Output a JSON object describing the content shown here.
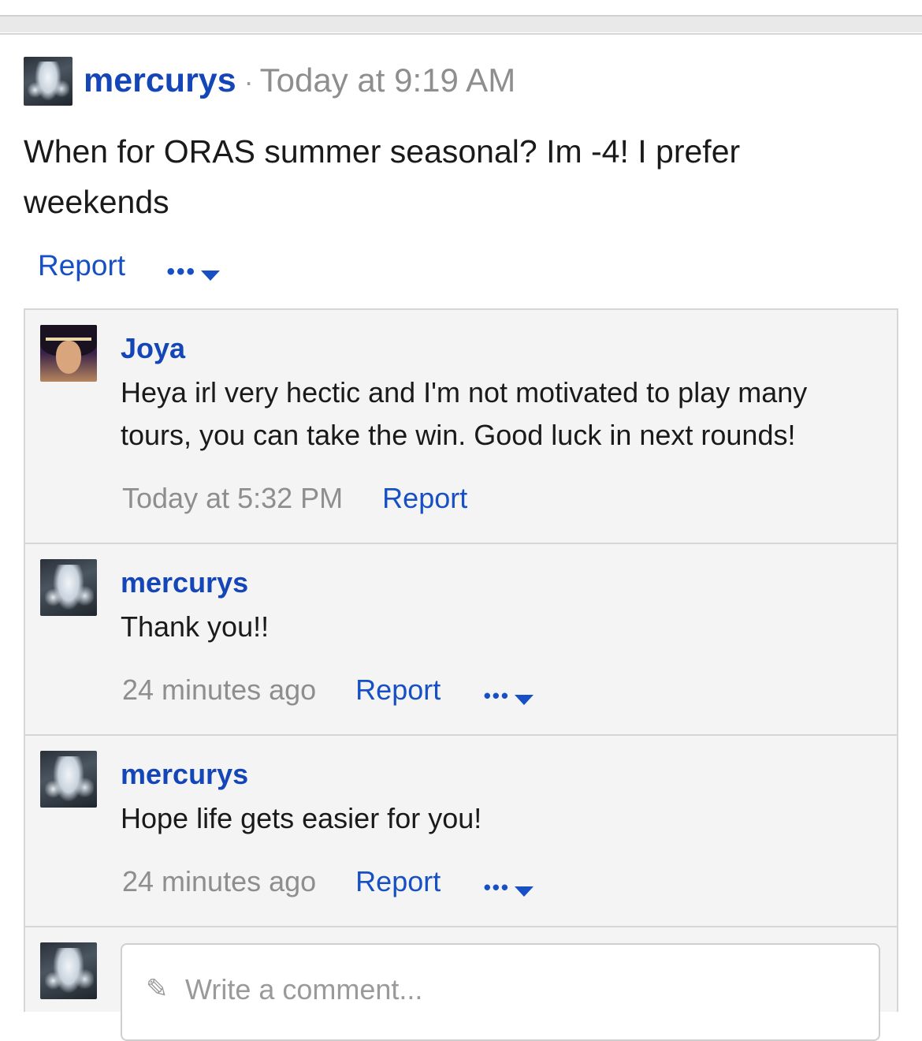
{
  "post": {
    "author": "mercurys",
    "separator": "·",
    "time": "Today at 9:19 AM",
    "body": "When for ORAS summer seasonal? Im -4! I prefer weekends",
    "report_label": "Report",
    "more_label": "•••"
  },
  "comments": [
    {
      "author": "Joya",
      "text": "Heya irl very hectic and I'm not motivated to play many tours, you can take the win. Good luck in next rounds!",
      "time": "Today at 5:32 PM",
      "report_label": "Report"
    },
    {
      "author": "mercurys",
      "text": "Thank you!!",
      "time": "24 minutes ago",
      "report_label": "Report",
      "more_label": "•••"
    },
    {
      "author": "mercurys",
      "text": "Hope life gets easier for you!",
      "time": "24 minutes ago",
      "report_label": "Report",
      "more_label": "•••"
    }
  ],
  "composer": {
    "placeholder": "Write a comment..."
  },
  "colors": {
    "link": "#1650c4",
    "author": "#1446b8",
    "muted": "#8e8e8e",
    "panel": "#f4f4f4"
  }
}
